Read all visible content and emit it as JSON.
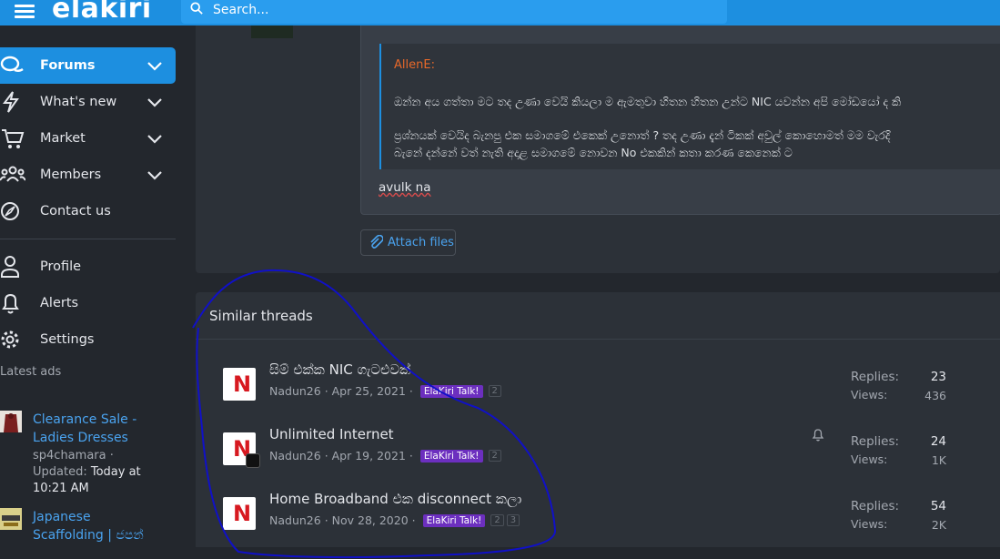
{
  "header": {
    "logo": "elakiri",
    "search_placeholder": "Search..."
  },
  "sidebar": {
    "nav": [
      {
        "label": "Forums",
        "icon": "chat-bubbles-icon",
        "expandable": true,
        "active": true
      },
      {
        "label": "What's new",
        "icon": "bolt-icon",
        "expandable": true
      },
      {
        "label": "Market",
        "icon": "cart-icon",
        "expandable": true
      },
      {
        "label": "Members",
        "icon": "users-icon",
        "expandable": true
      },
      {
        "label": "Contact us",
        "icon": "compass-icon",
        "expandable": false
      }
    ],
    "account": [
      {
        "label": "Profile",
        "icon": "user-icon"
      },
      {
        "label": "Alerts",
        "icon": "bell-icon"
      },
      {
        "label": "Settings",
        "icon": "gear-icon"
      }
    ],
    "latest_ads_heading": "Latest ads",
    "ads": [
      {
        "title_line1": "Clearance Sale -",
        "title_line2": "Ladies Dresses",
        "meta_line1": "sp4chamara ·",
        "meta_updated": "Updated:",
        "meta_when": "Today at",
        "meta_time": "10:21 AM"
      },
      {
        "title_line1": "Japanese",
        "title_line2": "Scaffolding | ජපන්"
      }
    ]
  },
  "post": {
    "quote_author": "AllenE:",
    "quote_line1": "ඔන්න අය ගත්තා මට තද උණා වෙයි කියලා ම ඇමතුවා හිතන හිතන උන්ට NIC යවන්න අපි මෝඩයෝ ද කි",
    "quote_line2": "ප්‍රශ්නයක් වෙයිද බැනපු එක සමාගමේ එකෙක් උනොත් ? තද උණා දැන් ටිකක් අවුල් කොහොමත් මම වැරදි",
    "quote_line3": "බැනේ දන්නේ වත් නැති අදාළ සමාගමේ නොවන No එකකින් කතා කරණ කෙනෙක් ට",
    "reply_text": "avulk na",
    "attach_label": "Attach files"
  },
  "similar": {
    "title": "Similar threads",
    "replies_label": "Replies:",
    "views_label": "Views:",
    "threads": [
      {
        "title": "සිම් එක්ක NIC ගැටළුවක්",
        "author": "Nadun26",
        "date": "· Apr 25, 2021 ·",
        "badge": "ElaKiri Talk!",
        "pages": [
          "2"
        ],
        "replies": "23",
        "views": "436",
        "watched": false
      },
      {
        "title": "Unlimited Internet",
        "author": "Nadun26",
        "date": "· Apr 19, 2021 ·",
        "badge": "ElaKiri Talk!",
        "pages": [
          "2"
        ],
        "replies": "24",
        "views": "1K",
        "watched": true
      },
      {
        "title": "Home Broadband එක disconnect කලා",
        "author": "Nadun26",
        "date": "· Nov 28, 2020 ·",
        "badge": "ElaKiri Talk!",
        "pages": [
          "2",
          "3"
        ],
        "replies": "54",
        "views": "2K",
        "watched": false
      }
    ]
  },
  "colors": {
    "accent": "#1d8fe0",
    "badge": "#6c2fbf",
    "avatar_letter": "#d71920",
    "annotation": "#1010c8"
  }
}
